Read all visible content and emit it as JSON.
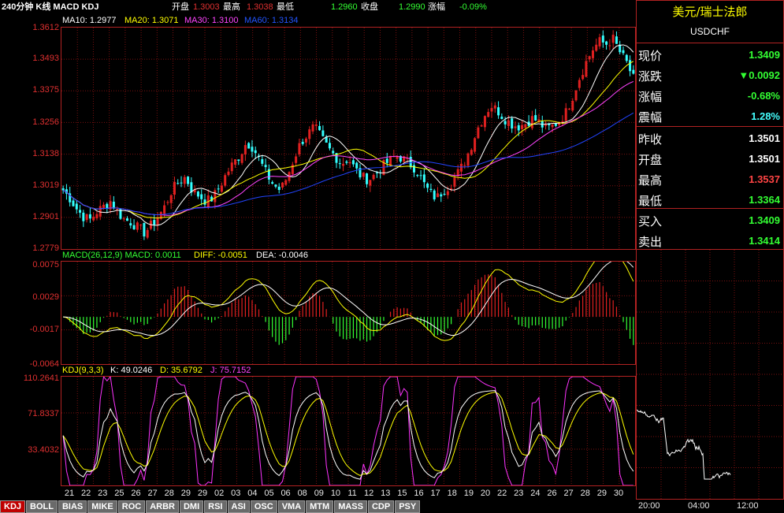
{
  "header": {
    "title": "240分钟 K线 MACD KDJ",
    "open_label": "开盘",
    "open_value": "1.3003",
    "high_label": "最高",
    "high_value": "1.3038",
    "low_label": "最低",
    "low_value": "1.2960",
    "close_label": "收盘",
    "close_value": "1.2990",
    "change_label": "涨幅",
    "change_value": "-0.09%"
  },
  "ma_legend": {
    "ma10": "MA10: 1.2977",
    "ma20": "MA20: 1.3071",
    "ma30": "MA30: 1.3100",
    "ma60": "MA60: 1.3134"
  },
  "macd_legend": {
    "name": "MACD(26,12,9) MACD: 0.0011",
    "diff": "DIFF: -0.0051",
    "dea": "DEA: -0.0046"
  },
  "kdj_legend": {
    "name": "KDJ(9,3,3)",
    "k": "K: 49.0246",
    "d": "D: 35.6792",
    "j": "J: 75.7152"
  },
  "price_axis": [
    "1.3612",
    "1.3493",
    "1.3375",
    "1.3256",
    "1.3138",
    "1.3019",
    "1.2901",
    "1.2779"
  ],
  "macd_axis": [
    "0.0075",
    "0.0029",
    "-0.0017",
    "-0.0064"
  ],
  "kdj_axis": [
    "110.2641",
    "71.8337",
    "33.4032"
  ],
  "x_axis": [
    "21",
    "22",
    "23",
    "25",
    "26",
    "27",
    "28",
    "29",
    "29",
    "02",
    "03",
    "04",
    "05",
    "06",
    "08",
    "09",
    "10",
    "11",
    "12",
    "13",
    "15",
    "16",
    "17",
    "18",
    "19",
    "20",
    "22",
    "23",
    "24",
    "26",
    "27",
    "28",
    "29",
    "30"
  ],
  "tabs": [
    "KDJ",
    "BOLL",
    "BIAS",
    "MIKE",
    "ROC",
    "ARBR",
    "DMI",
    "RSI",
    "ASI",
    "OSC",
    "VMA",
    "MTM",
    "MASS",
    "CDP",
    "PSY"
  ],
  "active_tab": "KDJ",
  "quote": {
    "name": "美元/瑞士法郎",
    "symbol": "USDCHF",
    "rows": [
      {
        "label": "现价",
        "value": "1.3409",
        "color": "#33ff33"
      },
      {
        "label": "涨跌",
        "value": "▼0.0092",
        "color": "#33ff33"
      },
      {
        "label": "涨幅",
        "value": "-0.68%",
        "color": "#33ff33"
      },
      {
        "label": "震幅",
        "value": "1.28%",
        "color": "#44ffff"
      },
      {
        "label": "昨收",
        "value": "1.3501",
        "color": "#ffffff"
      },
      {
        "label": "开盘",
        "value": "1.3501",
        "color": "#ffffff"
      },
      {
        "label": "最高",
        "value": "1.3537",
        "color": "#ff4444"
      },
      {
        "label": "最低",
        "value": "1.3364",
        "color": "#33ff33"
      },
      {
        "label": "买入",
        "value": "1.3409",
        "color": "#33ff33"
      },
      {
        "label": "卖出",
        "value": "1.3414",
        "color": "#33ff33"
      }
    ]
  },
  "mini_axis": [
    "20:00",
    "04:00",
    "12:00"
  ],
  "colors": {
    "up": "#e02020",
    "down": "#33ffff",
    "ma10": "#ffffff",
    "ma20": "#ffff00",
    "ma30": "#ff44ff",
    "ma60": "#2244ff",
    "grid": "#b22222",
    "kdj_k": "#ffffff",
    "kdj_d": "#ffff00",
    "kdj_j": "#ff33ff",
    "macd_up": "#e02020",
    "macd_down": "#33ff33"
  },
  "chart_data": {
    "type": "candlestick",
    "title": "240分钟 K线 MACD KDJ",
    "ylim": [
      1.2779,
      1.3612
    ],
    "ohlc_trend_close": [
      1.3,
      1.297,
      1.293,
      1.29,
      1.289,
      1.292,
      1.294,
      1.296,
      1.292,
      1.289,
      1.288,
      1.286,
      1.284,
      1.287,
      1.29,
      1.294,
      1.3,
      1.303,
      1.305,
      1.3,
      1.298,
      1.296,
      1.297,
      1.301,
      1.306,
      1.31,
      1.313,
      1.318,
      1.316,
      1.311,
      1.306,
      1.302,
      1.3,
      1.305,
      1.312,
      1.318,
      1.321,
      1.324,
      1.32,
      1.316,
      1.313,
      1.31,
      1.312,
      1.308,
      1.305,
      1.304,
      1.306,
      1.309,
      1.311,
      1.313,
      1.312,
      1.31,
      1.308,
      1.303,
      1.299,
      1.297,
      1.3,
      1.302,
      1.306,
      1.31,
      1.316,
      1.323,
      1.328,
      1.332,
      1.33,
      1.327,
      1.325,
      1.324,
      1.325,
      1.327,
      1.326,
      1.323,
      1.324,
      1.326,
      1.329,
      1.335,
      1.342,
      1.348,
      1.353,
      1.356,
      1.355,
      1.357,
      1.352,
      1.348,
      1.342
    ]
  }
}
